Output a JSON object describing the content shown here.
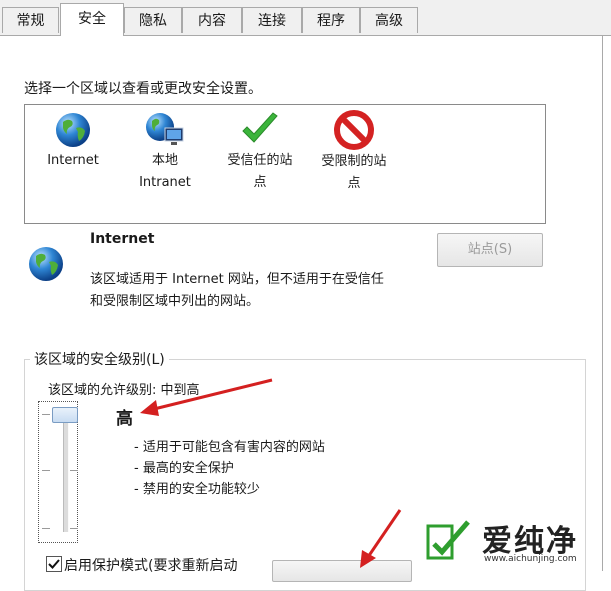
{
  "tabs": [
    "常规",
    "安全",
    "隐私",
    "内容",
    "连接",
    "程序",
    "高级"
  ],
  "active_tab": "安全",
  "instruction": "选择一个区域以查看或更改安全设置。",
  "zones": [
    {
      "line1": "Internet",
      "line2": "",
      "icon": "globe-icon"
    },
    {
      "line1": "本地",
      "line2": "Intranet",
      "icon": "intranet-icon"
    },
    {
      "line1": "受信任的站",
      "line2": "点",
      "icon": "checkmark-icon"
    },
    {
      "line1": "受限制的站",
      "line2": "点",
      "icon": "restricted-icon"
    }
  ],
  "selected_zone": {
    "name": "Internet",
    "description_line1": "该区域适用于 Internet 网站，但不适用于在受信任",
    "description_line2": "和受限制区域中列出的网站。"
  },
  "sites_button": "站点(S)",
  "security_level": {
    "group_label": "该区域的安全级别(L)",
    "allowed_levels": "该区域的允许级别: 中到高",
    "current_level": "高",
    "bullets": [
      "- 适用于可能包含有害内容的网站",
      "- 最高的安全保护",
      "- 禁用的安全功能较少"
    ]
  },
  "protected_mode": {
    "label": "启用保护模式(要求重新启动",
    "checked": true
  },
  "watermark": {
    "text": "爱纯净",
    "url": "www.aichunjing.com"
  },
  "colors": {
    "arrow": "#d42020",
    "watermark_green": "#2e9e2e"
  }
}
